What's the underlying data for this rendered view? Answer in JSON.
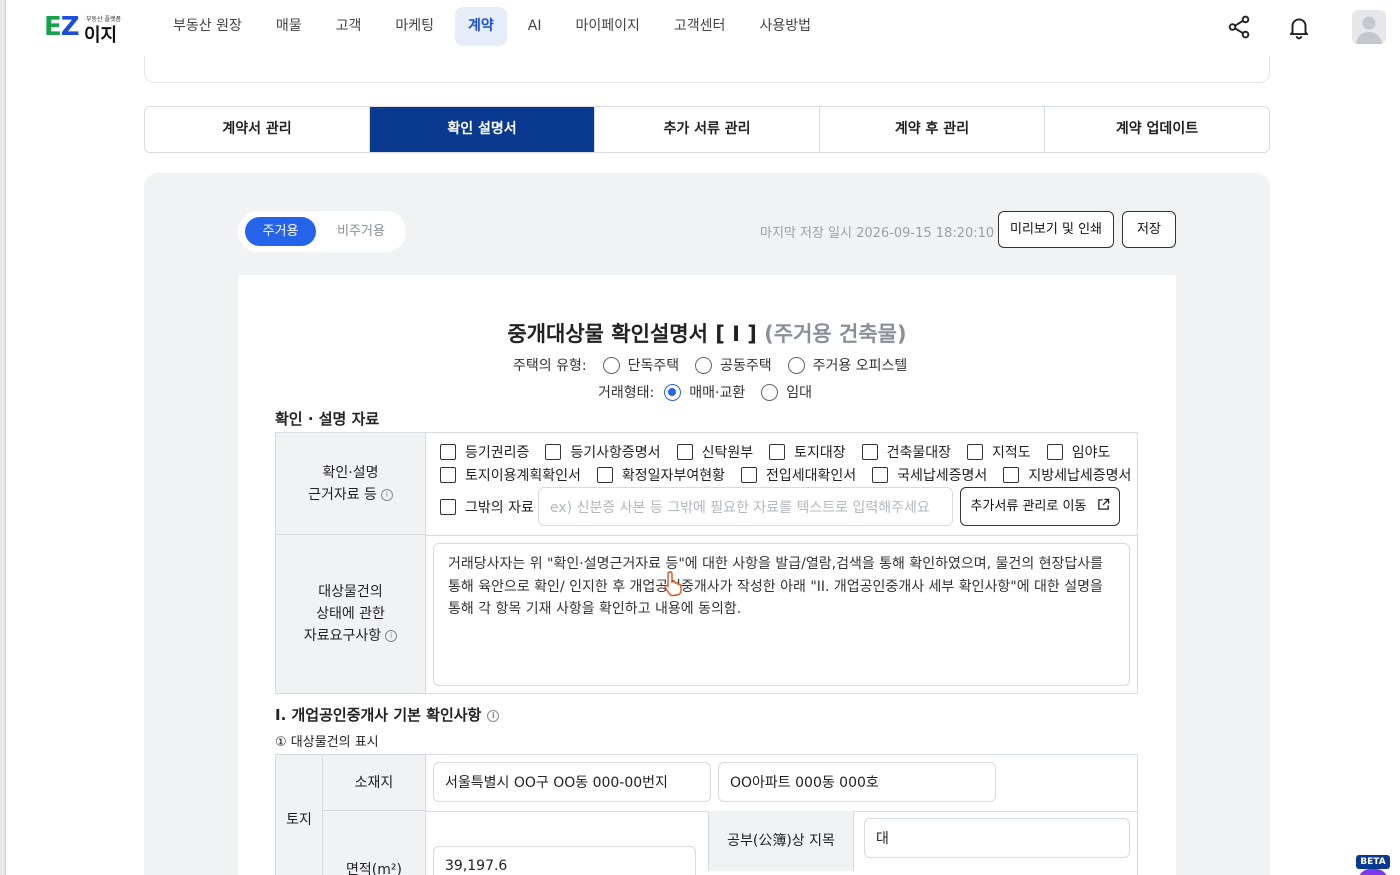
{
  "header": {
    "logo_sub": "부동산 플랫폼",
    "logo_ez": "EZ",
    "logo_iji": "이지",
    "nav": [
      "부동산 원장",
      "매물",
      "고객",
      "마케팅",
      "계약",
      "AI",
      "마이페이지",
      "고객센터",
      "사용방법"
    ],
    "active_nav": "계약",
    "share_icon": "share-icon",
    "bell_icon": "bell-icon",
    "avatar_icon": "user-avatar-icon"
  },
  "tabs": {
    "items": [
      "계약서 관리",
      "확인 설명서",
      "추가 서류 관리",
      "계약 후 관리",
      "계약 업데이트"
    ],
    "active": "확인 설명서"
  },
  "toolbar": {
    "type_on": "주거용",
    "type_off": "비주거용",
    "last_saved": "마지막 저장 일시 2026-09-15 18:20:10",
    "preview_label": "미리보기 및 인쇄",
    "save_label": "저장"
  },
  "doc": {
    "title_main": "중개대상물 확인설명서 [ I ]",
    "title_sub": "(주거용 건축물)",
    "house_type_label": "주택의 유형:",
    "house_types": [
      "단독주택",
      "공동주택",
      "주거용 오피스텔"
    ],
    "deal_label": "거래형태:",
    "deal_types": [
      "매매·교환",
      "임대"
    ],
    "deal_selected": "매매·교환",
    "section1": "확인 · 설명 자료",
    "basis_label_1": "확인·설명",
    "basis_label_2": "근거자료 등",
    "docs_row1": [
      "등기권리증",
      "등기사항증명서",
      "신탁원부",
      "토지대장",
      "건축물대장",
      "지적도",
      "임야도"
    ],
    "docs_row2": [
      "토지이용계획확인서",
      "확정일자부여현황",
      "전입세대확인서",
      "국세납세증명서",
      "지방세납세증명서"
    ],
    "other_label": "그밖의 자료",
    "other_placeholder": "ex) 신분증 사본 등 그밖에 필요한 자료를 텍스트로 입력해주세요",
    "move_button": "추가서류 관리로 이동",
    "request_label_1": "대상물건의",
    "request_label_2": "상태에 관한",
    "request_label_3": "자료요구사항",
    "request_text": "거래당사자는 위 \"확인·설명근거자료 등\"에 대한 사항을 발급/열람,검색을 통해 확인하였으며, 물건의 현장답사를 통해 육안으로 확인/ 인지한 후 개업공인중개사가 작성한 아래 \"II. 개업공인중개사 세부 확인사항\"에 대한 설명을 통해 각 항목 기재 사항을 확인하고 내용에 동의함.",
    "section2": "I. 개업공인중개사 기본 확인사항",
    "subsection": "① 대상물건의 표시",
    "land_label": "토지",
    "location_label": "소재지",
    "address": "서울특별시 OO구 OO동 000-00번지",
    "address_detail": "OO아파트 000동 000호",
    "area_label": "면적(m²)",
    "area_value": "39,197.6",
    "jimok_label": "공부(公簿)상 지목",
    "jimok_value": "대"
  },
  "badge": {
    "beta": "BETA"
  },
  "colors": {
    "primary": "#0a3a8f",
    "accent": "#2563eb",
    "panel": "#f1f2f4"
  }
}
